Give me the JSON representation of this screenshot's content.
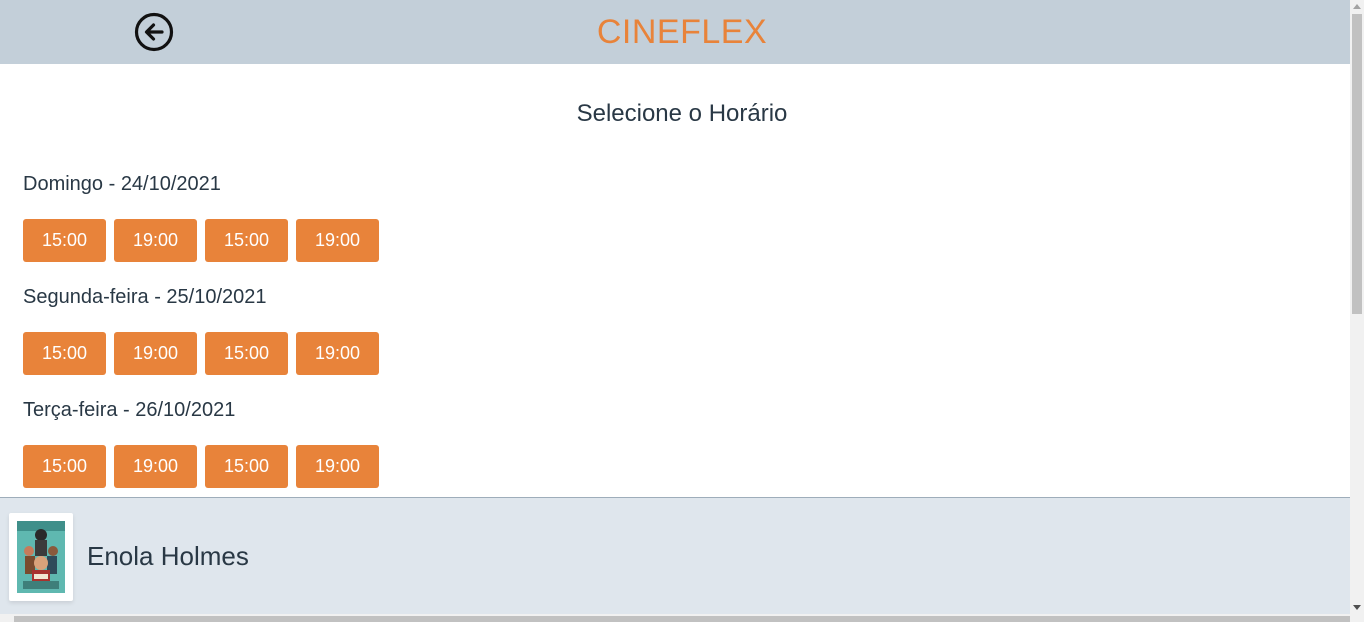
{
  "header": {
    "brand": "CINEFLEX",
    "back_icon": "arrow-left-circle-icon"
  },
  "page_title": "Selecione o Horário",
  "sessions": [
    {
      "label": "Domingo - 24/10/2021",
      "times": [
        "15:00",
        "19:00",
        "15:00",
        "19:00"
      ]
    },
    {
      "label": "Segunda-feira - 25/10/2021",
      "times": [
        "15:00",
        "19:00",
        "15:00",
        "19:00"
      ]
    },
    {
      "label": "Terça-feira - 26/10/2021",
      "times": [
        "15:00",
        "19:00",
        "15:00",
        "19:00"
      ]
    }
  ],
  "footer": {
    "movie_title": "Enola Holmes"
  },
  "colors": {
    "header_bg": "#c3cfd9",
    "accent": "#e8833a",
    "text": "#293845",
    "footer_bg": "#dfe6ed"
  }
}
